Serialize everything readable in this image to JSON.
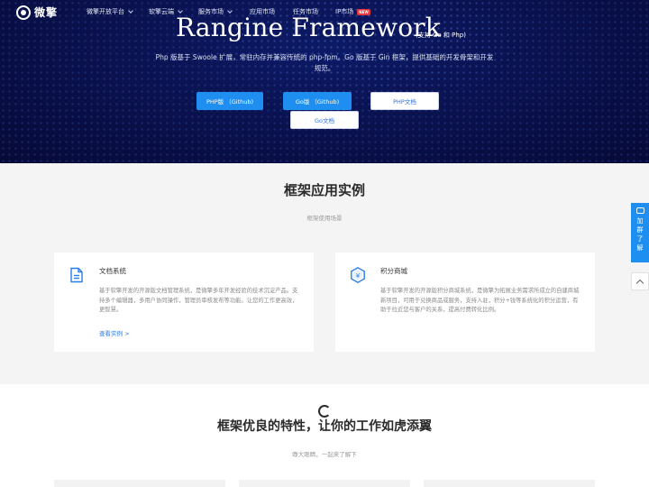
{
  "nav": {
    "logo_text": "微擎",
    "items": [
      {
        "label": "微擎开放平台",
        "dropdown": true
      },
      {
        "label": "软擎云端",
        "dropdown": true
      },
      {
        "label": "服务市场",
        "dropdown": true
      },
      {
        "label": "应用市场",
        "dropdown": false
      },
      {
        "label": "任务市场",
        "dropdown": false
      },
      {
        "label": "IP市场",
        "dropdown": false,
        "badge": "NEW"
      }
    ]
  },
  "hero": {
    "title": "Rangine Framework",
    "subtitle": "(支持 Go 和 Php)",
    "description": "Php 版基于 Swoole 扩展，常驻内存并兼容传统的 php-fpm。Go 版基于 Gin 框架，提供基础的开发骨架和开发规范。",
    "buttons": [
      {
        "label": "PHP版 （Github)",
        "style": "blue"
      },
      {
        "label": "Go版 （Github)",
        "style": "blue"
      },
      {
        "label": "PHP文档",
        "style": "white"
      },
      {
        "label": "Go文档",
        "style": "white"
      }
    ]
  },
  "section_cases": {
    "title": "框架应用实例",
    "subtitle": "框架使用场景",
    "cards": [
      {
        "icon": "document-icon",
        "title": "文档系统",
        "text": "基于软擎开发的开源版文档管理系统，是微擎多年开发经验的技术沉淀产品。支持多个编辑器，多用户协同操作，管理员审核发布等功能。让您的工作更高效，更智慧。",
        "link": "查看实例 >"
      },
      {
        "icon": "yuan-hexagon-icon",
        "title": "积分商城",
        "text": "基于软擎开发的开源版积分商城系统，是微擎为拓展业务需求所成立的自建商城新项目，可用于兑换商品或服务，支持入驻，积分+钱等系统化的积分运营，有助于拉近您与客户的关系，提高付费转化比例。",
        "link": ""
      }
    ]
  },
  "section_features": {
    "title": "框架优良的特性，让你的工作如虎添翼",
    "subtitle": "睁大眼睛，一起来了解下"
  },
  "side_widget": {
    "label_chars": [
      "加",
      "群",
      "了",
      "解"
    ]
  },
  "colors": {
    "hero_bg": "#0a1250",
    "accent": "#1e8ff0",
    "section_bg": "#f4f4f4"
  }
}
